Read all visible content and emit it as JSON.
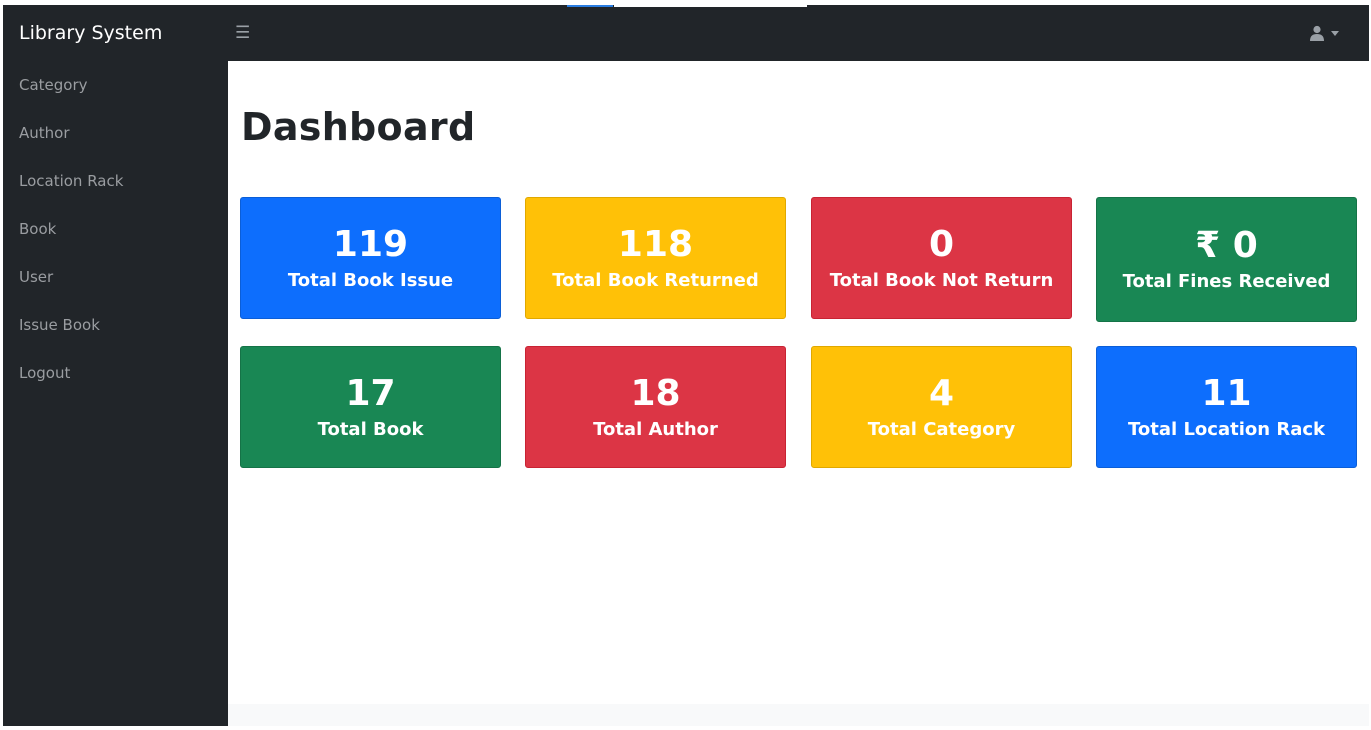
{
  "app": {
    "brand": "Library System"
  },
  "topbar": {
    "toggle_icon": "☰",
    "user_icon": "user-icon"
  },
  "sidebar": {
    "items": [
      {
        "label": "Category"
      },
      {
        "label": "Author"
      },
      {
        "label": "Location Rack"
      },
      {
        "label": "Book"
      },
      {
        "label": "User"
      },
      {
        "label": "Issue Book"
      },
      {
        "label": "Logout"
      }
    ]
  },
  "main": {
    "title": "Dashboard",
    "cards": [
      {
        "value": "119",
        "label": "Total Book Issue",
        "color": "#0d6efd"
      },
      {
        "value": "118",
        "label": "Total Book Returned",
        "color": "#ffc107"
      },
      {
        "value": "0",
        "label": "Total Book Not Return",
        "color": "#dc3545"
      },
      {
        "value": "₹ 0",
        "label": "Total Fines Received",
        "color": "#198754"
      },
      {
        "value": "17",
        "label": "Total Book",
        "color": "#198754"
      },
      {
        "value": "18",
        "label": "Total Author",
        "color": "#dc3545"
      },
      {
        "value": "4",
        "label": "Total Category",
        "color": "#ffc107"
      },
      {
        "value": "11",
        "label": "Total Location Rack",
        "color": "#0d6efd"
      }
    ]
  }
}
